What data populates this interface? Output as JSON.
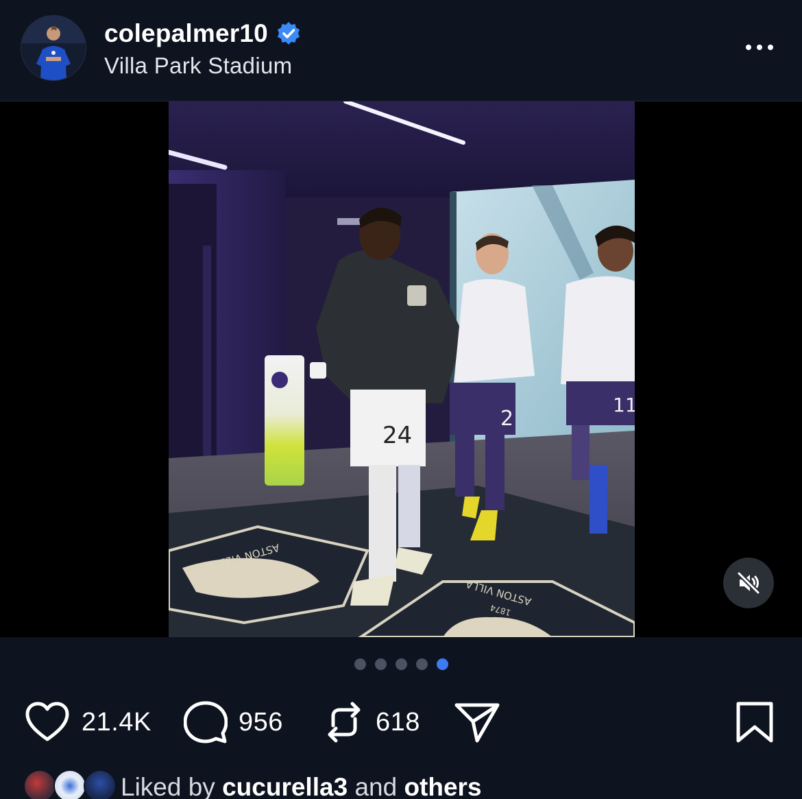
{
  "post": {
    "username": "colepalmer10",
    "location": "Villa Park Stadium",
    "verified": true
  },
  "media": {
    "pages": 5,
    "active_page": 5,
    "muted": true,
    "scene_text": {
      "mat_top": "ASTON VILLA",
      "mat_bottom": "ASTON VILLA",
      "mat_year": "1874",
      "shorts_number": "24",
      "teammate_number_1": "2",
      "teammate_number_2": "11"
    }
  },
  "actions": {
    "likes": "21.4K",
    "comments": "956",
    "reposts": "618"
  },
  "liked_by": {
    "prefix": "Liked by",
    "user": "cucurella3",
    "middle": "and",
    "suffix": "others"
  },
  "colors": {
    "background": "#0d131f",
    "verified_blue": "#3b8af5",
    "active_dot": "#3c7bf2",
    "inactive_dot": "#4b5262"
  },
  "icons": [
    "verified-badge-icon",
    "more-icon",
    "volume-muted-icon",
    "heart-icon",
    "comment-icon",
    "repost-icon",
    "share-icon",
    "bookmark-icon"
  ]
}
